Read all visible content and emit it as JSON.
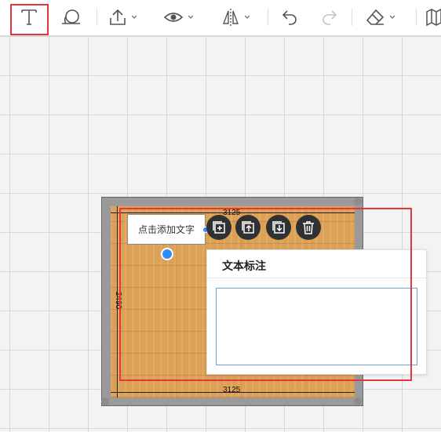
{
  "toolbar": {
    "tools": [
      {
        "name": "text-tool",
        "icon": "text-T-icon",
        "selected": true
      },
      {
        "name": "measure-tool",
        "icon": "tape-measure-icon"
      },
      {
        "name": "upload-tool",
        "icon": "upload-icon",
        "has_dropdown": true
      },
      {
        "name": "view-tool",
        "icon": "eye-icon",
        "has_dropdown": true
      },
      {
        "name": "mirror-tool",
        "icon": "mirror-icon",
        "has_dropdown": true
      },
      {
        "name": "undo-tool",
        "icon": "undo-icon"
      },
      {
        "name": "redo-tool",
        "icon": "redo-icon",
        "disabled": true
      },
      {
        "name": "eraser-tool",
        "icon": "eraser-icon",
        "has_dropdown": true
      },
      {
        "name": "map-tool",
        "icon": "map-icon"
      }
    ]
  },
  "room": {
    "dim_top": "3125",
    "dim_bottom": "3125",
    "dim_left": "2490",
    "floor_material": "wood"
  },
  "text_label": {
    "placeholder": "点击添加文字"
  },
  "actions": [
    {
      "name": "copy-button",
      "icon": "copy-add-icon"
    },
    {
      "name": "bring-forward-button",
      "icon": "bring-forward-icon"
    },
    {
      "name": "send-backward-button",
      "icon": "send-backward-icon"
    },
    {
      "name": "delete-button",
      "icon": "trash-icon"
    }
  ],
  "annotation_panel": {
    "title": "文本标注",
    "input_value": ""
  },
  "colors": {
    "accent_red": "#e5363b",
    "handle_blue": "#2f8cff",
    "action_button_bg": "#2f3133"
  }
}
